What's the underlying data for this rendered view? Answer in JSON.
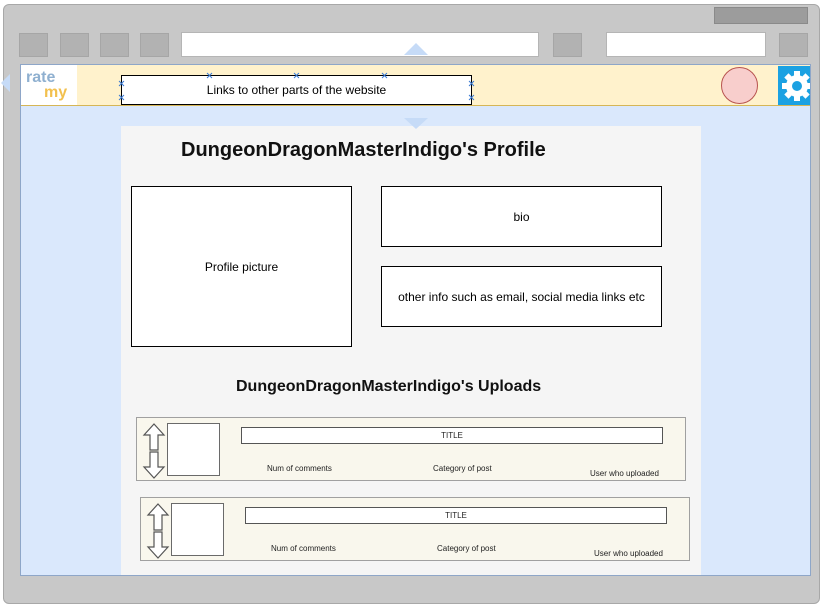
{
  "browser": {
    "toolbar_buttons": [
      "back-button",
      "forward-button",
      "refresh-button",
      "home-button"
    ],
    "address_value": "",
    "search_value": ""
  },
  "navbar": {
    "logo": {
      "line1": "rate",
      "line2": "my"
    },
    "links_label": "Links to other parts of the website",
    "settings_icon": "gear-icon",
    "colors": {
      "navbar_bg": "#fff2cc",
      "avatar": "#f8cecc",
      "settings_bg": "#1ba1e2",
      "viewport_bg": "#dae8fc"
    }
  },
  "profile": {
    "title": "DungeonDragonMasterIndigo's Profile",
    "picture_label": "Profile picture",
    "bio_label": "bio",
    "info_label": "other info such as email, social media links etc"
  },
  "uploads": {
    "title": "DungeonDragonMasterIndigo's Uploads",
    "posts": [
      {
        "title": "TITLE",
        "comments": "Num of comments",
        "category": "Category of post",
        "uploader": "User who uploaded"
      },
      {
        "title": "TITLE",
        "comments": "Num of comments",
        "category": "Category of post",
        "uploader": "User who uploaded"
      }
    ]
  }
}
